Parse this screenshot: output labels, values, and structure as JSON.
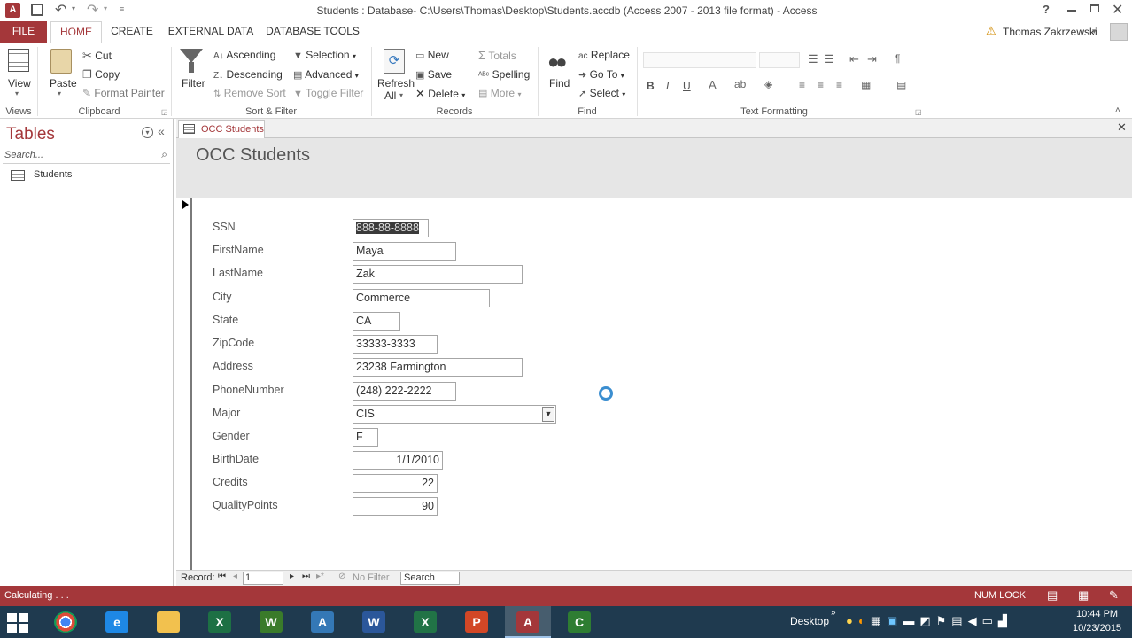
{
  "titlebar": {
    "title": "Students : Database- C:\\Users\\Thomas\\Desktop\\Students.accdb (Access 2007 - 2013 file format) - Access",
    "help": "?",
    "app_icon": "A"
  },
  "tabs": {
    "file": "FILE",
    "home": "HOME",
    "create": "CREATE",
    "external": "EXTERNAL DATA",
    "dbtools": "DATABASE TOOLS",
    "user": "Thomas Zakrzewski"
  },
  "ribbon": {
    "views": {
      "view": "View",
      "label": "Views"
    },
    "clipboard": {
      "paste": "Paste",
      "cut": "Cut",
      "copy": "Copy",
      "format_painter": "Format Painter",
      "label": "Clipboard"
    },
    "sort": {
      "filter": "Filter",
      "ascending": "Ascending",
      "descending": "Descending",
      "remove_sort": "Remove Sort",
      "selection": "Selection",
      "advanced": "Advanced",
      "toggle": "Toggle Filter",
      "label": "Sort & Filter"
    },
    "records": {
      "refresh": "Refresh",
      "refresh2": "All",
      "new": "New",
      "save": "Save",
      "delete": "Delete",
      "totals": "Totals",
      "spelling": "Spelling",
      "more": "More",
      "label": "Records"
    },
    "find": {
      "find": "Find",
      "replace": "Replace",
      "goto": "Go To",
      "select": "Select",
      "label": "Find"
    },
    "text": {
      "bold": "B",
      "italic": "I",
      "underline": "U",
      "label": "Text Formatting"
    }
  },
  "nav": {
    "title": "Tables",
    "search_placeholder": "Search...",
    "items": [
      {
        "label": "Students"
      }
    ]
  },
  "doc": {
    "tab": "OCC Students",
    "form_title": "OCC Students",
    "fields": [
      {
        "label": "SSN",
        "value": "888-88-8888"
      },
      {
        "label": "FirstName",
        "value": "Maya"
      },
      {
        "label": "LastName",
        "value": "Zak"
      },
      {
        "label": "City",
        "value": "Commerce"
      },
      {
        "label": "State",
        "value": "CA"
      },
      {
        "label": "ZipCode",
        "value": "33333-3333"
      },
      {
        "label": "Address",
        "value": "23238 Farmington"
      },
      {
        "label": "PhoneNumber",
        "value": "(248) 222-2222"
      },
      {
        "label": "Major",
        "value": "CIS"
      },
      {
        "label": "Gender",
        "value": "F"
      },
      {
        "label": "BirthDate",
        "value": "1/1/2010"
      },
      {
        "label": "Credits",
        "value": "22"
      },
      {
        "label": "QualityPoints",
        "value": "90"
      }
    ],
    "recnav": {
      "label": "Record:",
      "current": "1",
      "nofilter": "No Filter",
      "search": "Search"
    }
  },
  "status": {
    "left": "Calculating . . .",
    "numlock": "NUM LOCK"
  },
  "taskbar": {
    "desktop": "Desktop",
    "time": "10:44 PM",
    "date": "10/23/2015",
    "apps": [
      {
        "name": "chrome",
        "letter": "",
        "color": "#dd4b39"
      },
      {
        "name": "ie",
        "letter": "e",
        "color": "#1e88e5"
      },
      {
        "name": "explorer",
        "letter": "",
        "color": "#f2c14e"
      },
      {
        "name": "excel-green",
        "letter": "X",
        "color": "#1d7044"
      },
      {
        "name": "wordperfect",
        "letter": "W",
        "color": "#3a7b2a"
      },
      {
        "name": "paint",
        "letter": "A",
        "color": "#3478b6"
      },
      {
        "name": "word",
        "letter": "W",
        "color": "#2b579a"
      },
      {
        "name": "excel",
        "letter": "X",
        "color": "#217346"
      },
      {
        "name": "powerpoint",
        "letter": "P",
        "color": "#d24726"
      },
      {
        "name": "access",
        "letter": "A",
        "color": "#a4373a"
      },
      {
        "name": "camtasia",
        "letter": "C",
        "color": "#2e7d32"
      }
    ]
  },
  "colors": {
    "accent": "#a4373a",
    "taskbar": "#1f3a4f"
  }
}
